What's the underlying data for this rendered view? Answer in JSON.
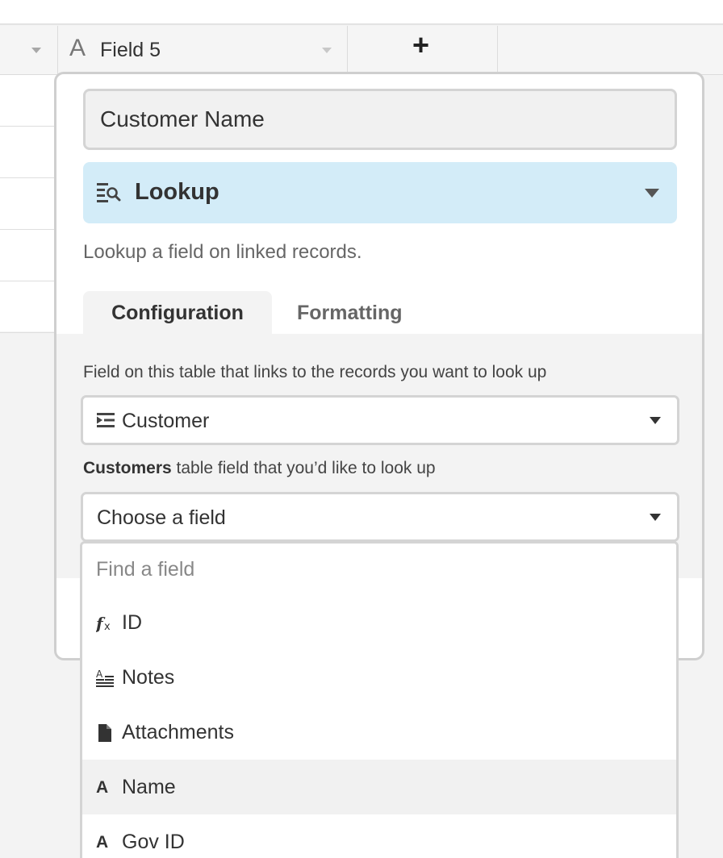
{
  "header": {
    "field5_type_icon": "A",
    "field5_name": "Field 5",
    "add_field_icon": "+"
  },
  "panel": {
    "name_value": "Customer Name",
    "field_type": {
      "label": "Lookup",
      "icon": "lookup-icon"
    },
    "description": "Lookup a field on linked records.",
    "tabs": [
      {
        "label": "Configuration",
        "active": true
      },
      {
        "label": "Formatting",
        "active": false
      }
    ],
    "config": {
      "link_label": "Field on this table that links to the records you want to look up",
      "link_selected": "Customer",
      "lookup_label_bold": "Customers",
      "lookup_label_rest": " table field that you’d like to look up",
      "lookup_selected": "Choose a field"
    }
  },
  "dropdown": {
    "search_placeholder": "Find a field",
    "options": [
      {
        "label": "ID",
        "icon": "formula-icon"
      },
      {
        "label": "Notes",
        "icon": "long-text-icon"
      },
      {
        "label": "Attachments",
        "icon": "attachment-icon"
      },
      {
        "label": "Name",
        "icon": "single-line-text-icon",
        "highlighted": true
      },
      {
        "label": "Gov ID",
        "icon": "single-line-text-icon"
      }
    ],
    "text_glyph": "A"
  },
  "colors": {
    "type_select_bg": "#d3ecf8",
    "panel_border": "#cfcfcf",
    "highlight_row": "#f1f1f1"
  }
}
